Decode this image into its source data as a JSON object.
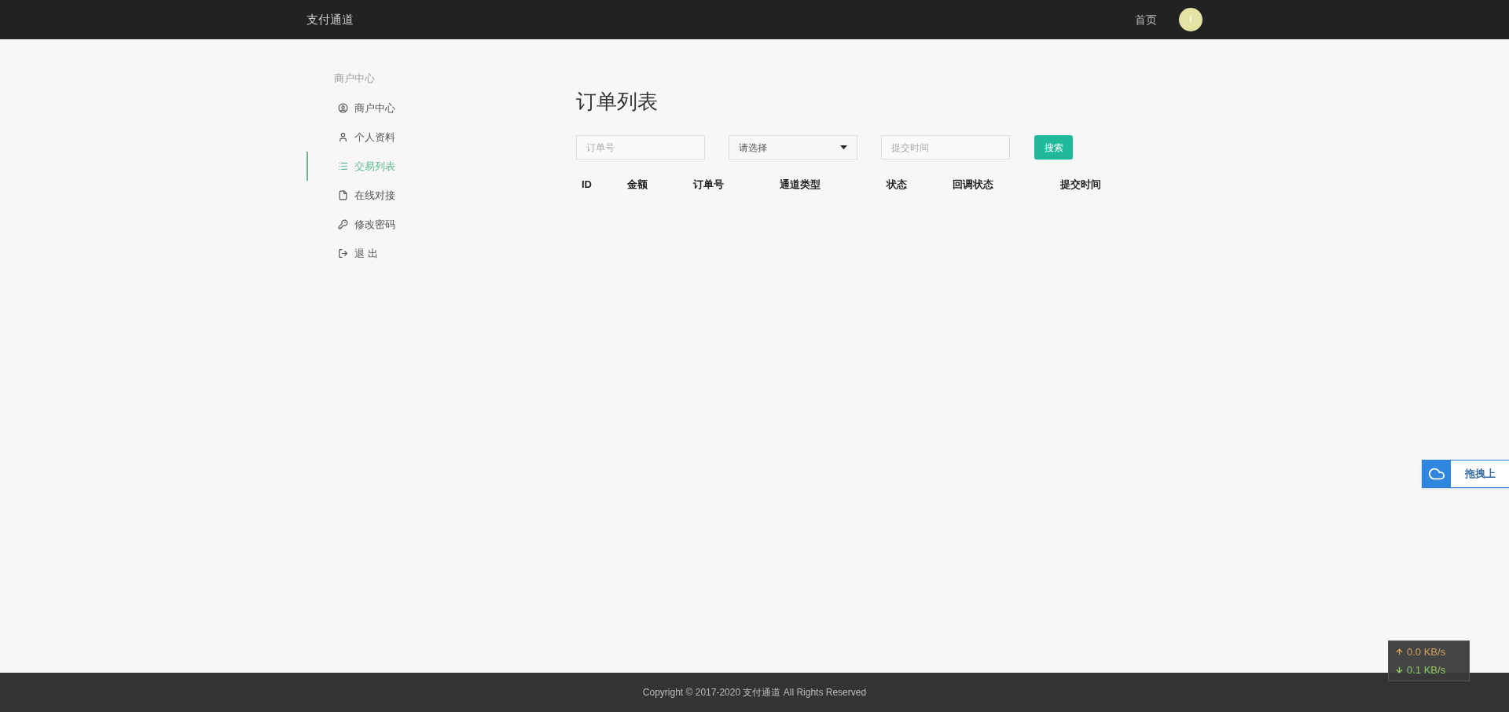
{
  "navbar": {
    "brand": "支付通道",
    "links": [
      "首页"
    ],
    "avatar": "I"
  },
  "sidebar": {
    "heading": "商户中心",
    "items": [
      {
        "label": "商户中心",
        "selected": false
      },
      {
        "label": "个人资料",
        "selected": false
      },
      {
        "label": "交易列表",
        "selected": true
      },
      {
        "label": "在线对接",
        "selected": false
      },
      {
        "label": "修改密码",
        "selected": false
      },
      {
        "label": "退 出",
        "selected": false
      }
    ]
  },
  "main": {
    "title": "订单列表",
    "filters": {
      "order_no": {
        "placeholder": "订单号"
      },
      "select": {
        "value": "请选择"
      },
      "time": {
        "placeholder": "提交时间"
      },
      "button": "搜索"
    },
    "table": {
      "columns": [
        "ID",
        "金额",
        "订单号",
        "通道类型",
        "状态",
        "回调状态",
        "提交时间"
      ]
    }
  },
  "upload_widget": {
    "label": "拖拽上"
  },
  "speed_meter": {
    "up": "0.0 KB/s",
    "down": "0.1 KB/s"
  },
  "footer": "Copyright © 2017-2020 支付通道 All Rights Reserved"
}
